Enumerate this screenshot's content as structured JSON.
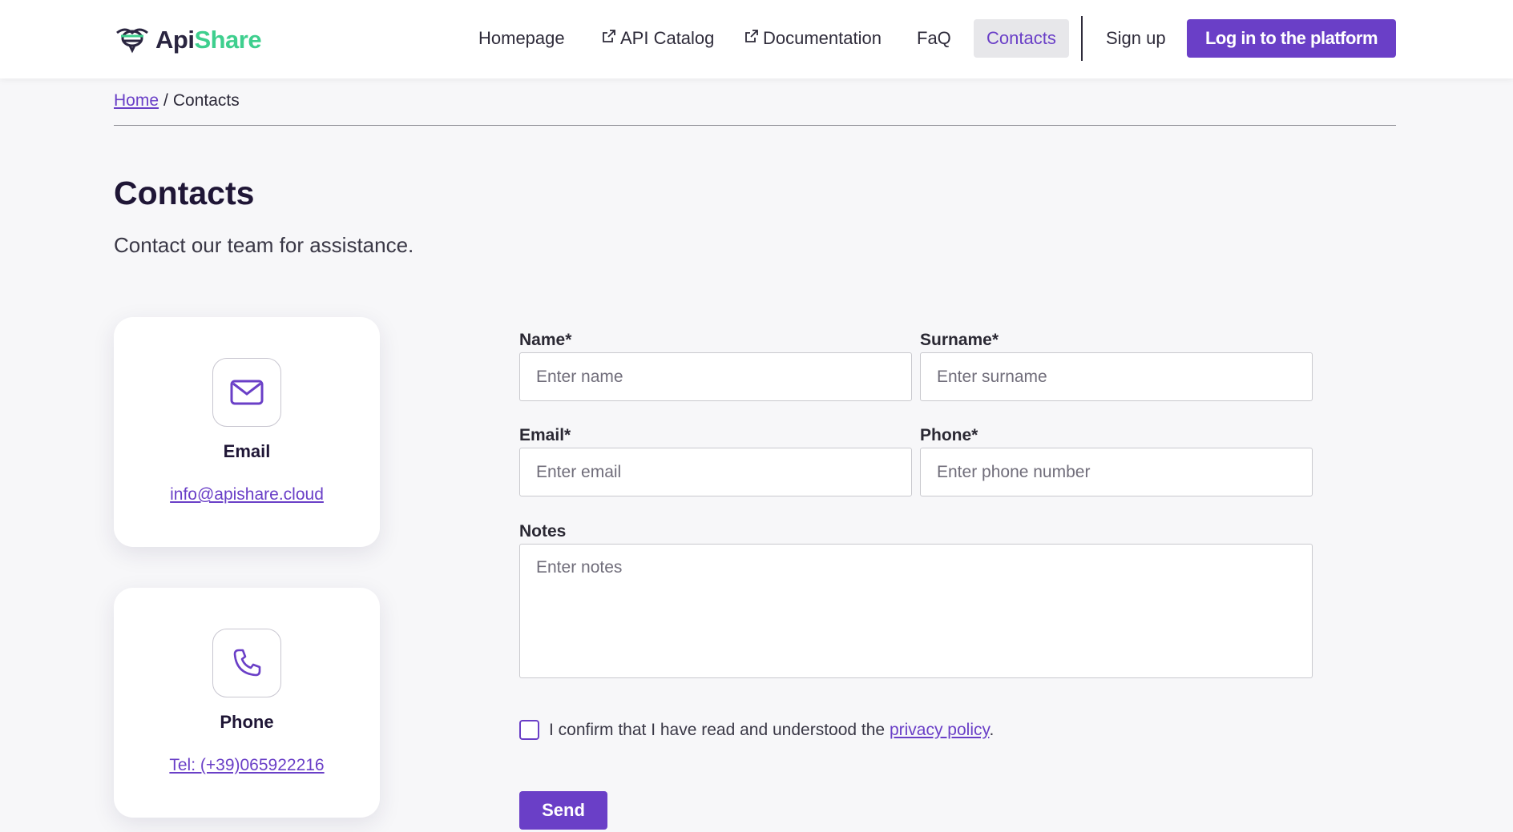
{
  "brand": {
    "part1": "Api",
    "part2": "Share"
  },
  "nav": {
    "homepage": "Homepage",
    "api_catalog": "API Catalog",
    "documentation": "Documentation",
    "faq": "FaQ",
    "contacts": "Contacts",
    "signup": "Sign up",
    "login": "Log in to the platform"
  },
  "breadcrumb": {
    "home": "Home",
    "separator": "/",
    "current": "Contacts"
  },
  "page": {
    "title": "Contacts",
    "subtitle": "Contact our team for assistance."
  },
  "cards": {
    "email": {
      "icon": "mail-icon",
      "label": "Email",
      "value": "info@apishare.cloud"
    },
    "phone": {
      "icon": "phone-icon",
      "label": "Phone",
      "value": "Tel: (+39)065922216"
    }
  },
  "form": {
    "name": {
      "label": "Name*",
      "placeholder": "Enter name",
      "value": ""
    },
    "surname": {
      "label": "Surname*",
      "placeholder": "Enter surname",
      "value": ""
    },
    "email": {
      "label": "Email*",
      "placeholder": "Enter email",
      "value": ""
    },
    "phone": {
      "label": "Phone*",
      "placeholder": "Enter phone number",
      "value": ""
    },
    "notes": {
      "label": "Notes",
      "placeholder": "Enter notes",
      "value": ""
    },
    "consent_text": "I confirm that I have read and understood the",
    "consent_link": "privacy policy",
    "consent_end": ".",
    "consent_checked": false,
    "send": "Send"
  },
  "colors": {
    "accent": "#6a3fc7",
    "brand_green": "#3ecf8e",
    "title": "#1f1636",
    "background": "#f7f7f9"
  }
}
